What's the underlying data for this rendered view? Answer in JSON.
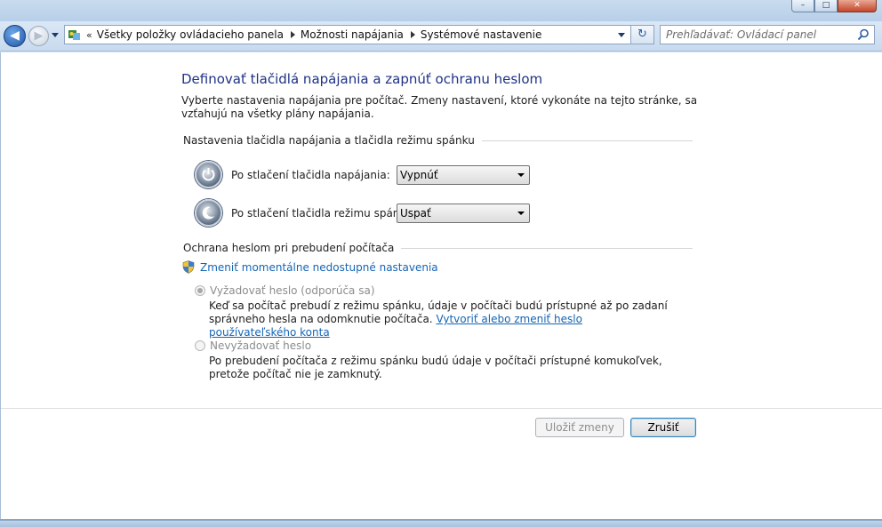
{
  "window": {
    "controls": {
      "minimize": "–",
      "maximize": "□",
      "close": "✕"
    }
  },
  "nav": {
    "back_glyph": "◀",
    "forward_glyph": "▶",
    "refresh_glyph": "↻",
    "breadcrumb_prefix": "«",
    "breadcrumbs": [
      "Všetky položky ovládacieho panela",
      "Možnosti napájania",
      "Systémové nastavenie"
    ],
    "search_placeholder": "Prehľadávať: Ovládací panel"
  },
  "page": {
    "title": "Definovať tlačidlá napájania a zapnúť ochranu heslom",
    "intro": "Vyberte nastavenia napájania pre počítač. Zmeny nastavení, ktoré vykonáte na tejto stránke, sa vzťahujú na všetky plány napájania.",
    "section_buttons": "Nastavenia tlačidla napájania a tlačidla režimu spánku",
    "power_button": {
      "label": "Po stlačení tlačidla napájania:",
      "value": "Vypnúť"
    },
    "sleep_button": {
      "label": "Po stlačení tlačidla režimu spánku:",
      "value": "Uspať"
    },
    "section_password": "Ochrana heslom pri prebudení počítača",
    "change_settings_link": "Zmeniť momentálne nedostupné nastavenia",
    "require_password": {
      "label": "Vyžadovať heslo (odporúča sa)",
      "desc": "Keď sa počítač prebudí z režimu spánku, údaje v počítači budú prístupné až po zadaní správneho hesla na odomknutie počítača.",
      "link": "Vytvoriť alebo zmeniť heslo používateľského konta",
      "checked": true
    },
    "no_password": {
      "label": "Nevyžadovať heslo",
      "desc": "Po prebudení počítača z režimu spánku budú údaje v počítači prístupné komukoľvek, pretože počítač nie je zamknutý.",
      "checked": false
    },
    "save_button": "Uložiť zmeny",
    "cancel_button": "Zrušiť"
  },
  "colors": {
    "title": "#1e3287",
    "link": "#1565b5",
    "disabled_text": "#8d8d8d"
  }
}
